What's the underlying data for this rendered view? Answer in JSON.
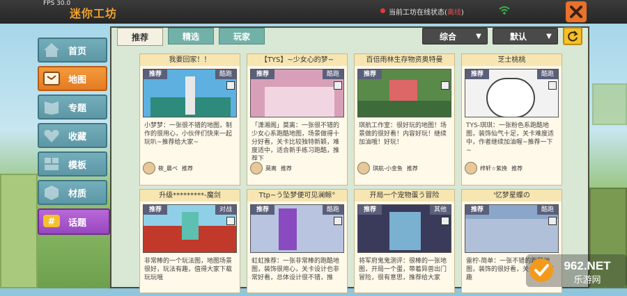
{
  "topbar": {
    "fps": "FPS 30.0",
    "title": "迷你工坊",
    "status_prefix": "当前工坊在线状态(",
    "status_value": "离线",
    "status_suffix": ")"
  },
  "sidenav": {
    "items": [
      {
        "label": "首页"
      },
      {
        "label": "地图"
      },
      {
        "label": "专题"
      },
      {
        "label": "收藏"
      },
      {
        "label": "模板"
      },
      {
        "label": "材质"
      },
      {
        "label": "话题"
      }
    ],
    "active_index": 1
  },
  "tabs": [
    {
      "label": "推荐"
    },
    {
      "label": "精选"
    },
    {
      "label": "玩家"
    }
  ],
  "active_tab": 0,
  "filters": {
    "sort_label": "综合",
    "order_label": "默认"
  },
  "cards": [
    {
      "title": "我要回家！！",
      "tag": "推荐",
      "mode": "酷跑",
      "desc": "小梦梦：一张很不错的地图，制作的很用心，小伙伴们快来一起玩叭~推荐给大家~",
      "author": "筱_晨ペ",
      "rec": "推荐",
      "img": "#5db0e0"
    },
    {
      "title": "【TYS】~少女心的梦~",
      "tag": "推荐",
      "mode": "酷跑",
      "desc": "「潇湘阁」莫离：一张很不错的少女心系跑酷地图，场景做得十分好看，关卡比较独特新颖，难度适中，适合新手练习跑酷，推荐下",
      "author": "莫离",
      "rec": "推荐",
      "img": "#d8a0b8"
    },
    {
      "title": "百倍雨林生存物资奥特曼",
      "tag": "推荐",
      "mode": "",
      "desc": "琪航工作室：很好玩的地图！场景做的很好看！内容好玩！继续加油哦！好玩！",
      "author": "琪航-小金鱼",
      "rec": "推荐",
      "img": "#5a8a4a"
    },
    {
      "title": "芝士桃桃",
      "tag": "推荐",
      "mode": "酷跑",
      "desc": "TYS-琪琪：一张粉色系跑酷地图，装饰仙气十足，关卡难度适中，作者继续加油喔~推荐一下~",
      "author": "梓轩☆紫挽",
      "rec": "推荐",
      "img": "#f2f2f2"
    },
    {
      "title": "升级*********-魔剑",
      "tag": "推荐",
      "mode": "对战",
      "desc": "非常棒的一个玩法图，地图场景很好，玩法有趣，值得大家下载玩玩哦",
      "author": "",
      "rec": "",
      "img": "#c0392b"
    },
    {
      "title": "Ttp~う坠梦便可见澜鲸°",
      "tag": "推荐",
      "mode": "酷跑",
      "desc": "虹虹推荐：一张非常棒的跑酷地图，装饰很用心，关卡设计也非常好看，总体设计很不错，推",
      "author": "",
      "rec": "",
      "img": "#b8c4e0"
    },
    {
      "title": "开局一个宠物蛋う冒险",
      "tag": "推荐",
      "mode": "其他",
      "desc": "将军府鬼鬼测评：很棒的一张地图，开局一个蛋，带着异兽出门冒险，很有意思，推荐给大家",
      "author": "",
      "rec": "",
      "img": "#3a3a5a"
    },
    {
      "title": "'忆梦星蝶の",
      "tag": "推荐",
      "mode": "酷跑",
      "desc": "雷柠-简单：一张不错的跑酷地图，装饰的很好看，关卡也很有趣",
      "author": "",
      "rec": "",
      "img": "#8aa6c8"
    }
  ],
  "watermark": {
    "brand": "962.NET",
    "sub": "乐游网"
  }
}
